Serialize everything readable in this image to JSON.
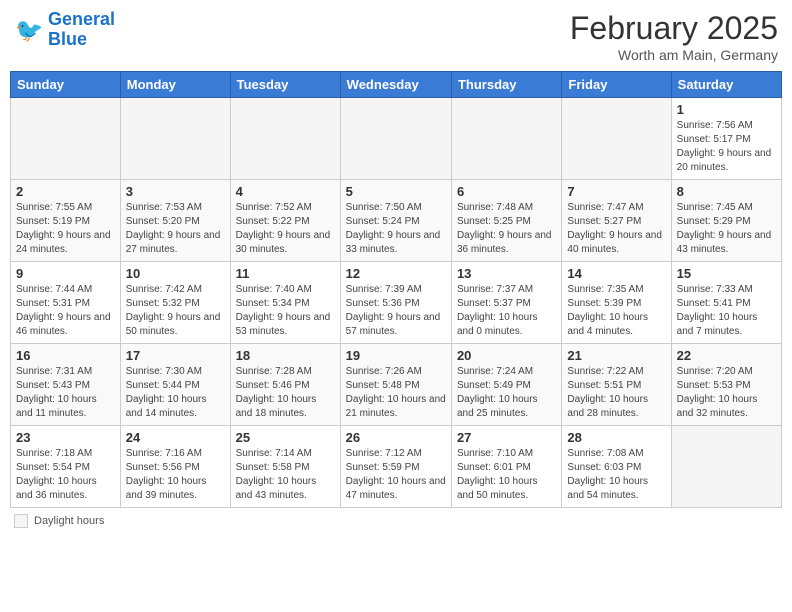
{
  "header": {
    "logo_text_general": "General",
    "logo_text_blue": "Blue",
    "month_year": "February 2025",
    "location": "Worth am Main, Germany"
  },
  "days_of_week": [
    "Sunday",
    "Monday",
    "Tuesday",
    "Wednesday",
    "Thursday",
    "Friday",
    "Saturday"
  ],
  "weeks": [
    {
      "days": [
        {
          "num": "",
          "info": "",
          "empty": true
        },
        {
          "num": "",
          "info": "",
          "empty": true
        },
        {
          "num": "",
          "info": "",
          "empty": true
        },
        {
          "num": "",
          "info": "",
          "empty": true
        },
        {
          "num": "",
          "info": "",
          "empty": true
        },
        {
          "num": "",
          "info": "",
          "empty": true
        },
        {
          "num": "1",
          "info": "Sunrise: 7:56 AM\nSunset: 5:17 PM\nDaylight: 9 hours and 20 minutes."
        }
      ]
    },
    {
      "days": [
        {
          "num": "2",
          "info": "Sunrise: 7:55 AM\nSunset: 5:19 PM\nDaylight: 9 hours and 24 minutes."
        },
        {
          "num": "3",
          "info": "Sunrise: 7:53 AM\nSunset: 5:20 PM\nDaylight: 9 hours and 27 minutes."
        },
        {
          "num": "4",
          "info": "Sunrise: 7:52 AM\nSunset: 5:22 PM\nDaylight: 9 hours and 30 minutes."
        },
        {
          "num": "5",
          "info": "Sunrise: 7:50 AM\nSunset: 5:24 PM\nDaylight: 9 hours and 33 minutes."
        },
        {
          "num": "6",
          "info": "Sunrise: 7:48 AM\nSunset: 5:25 PM\nDaylight: 9 hours and 36 minutes."
        },
        {
          "num": "7",
          "info": "Sunrise: 7:47 AM\nSunset: 5:27 PM\nDaylight: 9 hours and 40 minutes."
        },
        {
          "num": "8",
          "info": "Sunrise: 7:45 AM\nSunset: 5:29 PM\nDaylight: 9 hours and 43 minutes."
        }
      ]
    },
    {
      "days": [
        {
          "num": "9",
          "info": "Sunrise: 7:44 AM\nSunset: 5:31 PM\nDaylight: 9 hours and 46 minutes."
        },
        {
          "num": "10",
          "info": "Sunrise: 7:42 AM\nSunset: 5:32 PM\nDaylight: 9 hours and 50 minutes."
        },
        {
          "num": "11",
          "info": "Sunrise: 7:40 AM\nSunset: 5:34 PM\nDaylight: 9 hours and 53 minutes."
        },
        {
          "num": "12",
          "info": "Sunrise: 7:39 AM\nSunset: 5:36 PM\nDaylight: 9 hours and 57 minutes."
        },
        {
          "num": "13",
          "info": "Sunrise: 7:37 AM\nSunset: 5:37 PM\nDaylight: 10 hours and 0 minutes."
        },
        {
          "num": "14",
          "info": "Sunrise: 7:35 AM\nSunset: 5:39 PM\nDaylight: 10 hours and 4 minutes."
        },
        {
          "num": "15",
          "info": "Sunrise: 7:33 AM\nSunset: 5:41 PM\nDaylight: 10 hours and 7 minutes."
        }
      ]
    },
    {
      "days": [
        {
          "num": "16",
          "info": "Sunrise: 7:31 AM\nSunset: 5:43 PM\nDaylight: 10 hours and 11 minutes."
        },
        {
          "num": "17",
          "info": "Sunrise: 7:30 AM\nSunset: 5:44 PM\nDaylight: 10 hours and 14 minutes."
        },
        {
          "num": "18",
          "info": "Sunrise: 7:28 AM\nSunset: 5:46 PM\nDaylight: 10 hours and 18 minutes."
        },
        {
          "num": "19",
          "info": "Sunrise: 7:26 AM\nSunset: 5:48 PM\nDaylight: 10 hours and 21 minutes."
        },
        {
          "num": "20",
          "info": "Sunrise: 7:24 AM\nSunset: 5:49 PM\nDaylight: 10 hours and 25 minutes."
        },
        {
          "num": "21",
          "info": "Sunrise: 7:22 AM\nSunset: 5:51 PM\nDaylight: 10 hours and 28 minutes."
        },
        {
          "num": "22",
          "info": "Sunrise: 7:20 AM\nSunset: 5:53 PM\nDaylight: 10 hours and 32 minutes."
        }
      ]
    },
    {
      "days": [
        {
          "num": "23",
          "info": "Sunrise: 7:18 AM\nSunset: 5:54 PM\nDaylight: 10 hours and 36 minutes."
        },
        {
          "num": "24",
          "info": "Sunrise: 7:16 AM\nSunset: 5:56 PM\nDaylight: 10 hours and 39 minutes."
        },
        {
          "num": "25",
          "info": "Sunrise: 7:14 AM\nSunset: 5:58 PM\nDaylight: 10 hours and 43 minutes."
        },
        {
          "num": "26",
          "info": "Sunrise: 7:12 AM\nSunset: 5:59 PM\nDaylight: 10 hours and 47 minutes."
        },
        {
          "num": "27",
          "info": "Sunrise: 7:10 AM\nSunset: 6:01 PM\nDaylight: 10 hours and 50 minutes."
        },
        {
          "num": "28",
          "info": "Sunrise: 7:08 AM\nSunset: 6:03 PM\nDaylight: 10 hours and 54 minutes."
        },
        {
          "num": "",
          "info": "",
          "empty": true
        }
      ]
    }
  ],
  "legend": {
    "label": "Daylight hours"
  },
  "colors": {
    "header_bg": "#3a7bd5",
    "logo_blue": "#1a73c8"
  }
}
